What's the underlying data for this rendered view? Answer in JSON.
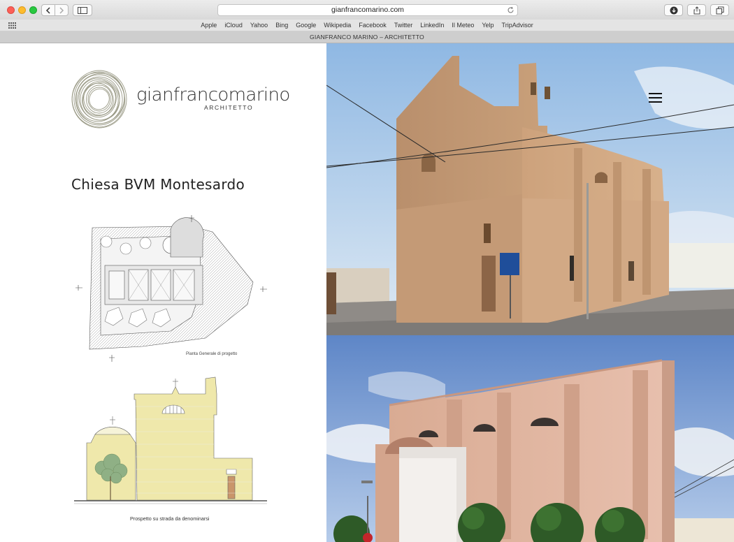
{
  "browser": {
    "url": "gianfrancomarino.com",
    "tab_title": "GIANFRANCO MARINO – ARCHITETTO",
    "bookmarks": [
      "Apple",
      "iCloud",
      "Yahoo",
      "Bing",
      "Google",
      "Wikipedia",
      "Facebook",
      "Twitter",
      "LinkedIn",
      "Il Meteo",
      "Yelp",
      "TripAdvisor"
    ]
  },
  "site": {
    "logo_name": "gianfrancomarino",
    "logo_subtitle": "ARCHITETTO",
    "project_title": "Chiesa BVM Montesardo",
    "plan_caption": "Pianta Generale di progetto",
    "elevation_caption": "Prospetto su strada da denominarsi"
  },
  "colors": {
    "logo_mark": "#9a9a86",
    "elevation_stone": "#efe8ab",
    "sky_top": "#9fc4e9",
    "stone": "#c79a73",
    "pink_wall": "#e3b8a3"
  },
  "icons": {
    "menu": "hamburger-menu-icon"
  }
}
